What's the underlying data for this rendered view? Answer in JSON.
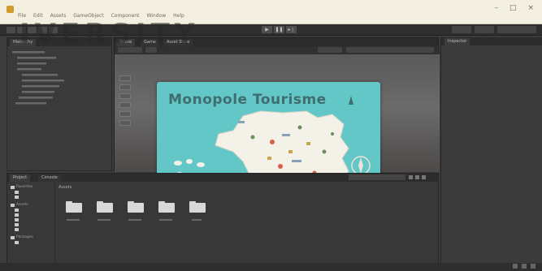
{
  "window": {
    "title": "",
    "menu": [
      "File",
      "Edit",
      "Assets",
      "GameObject",
      "Component",
      "Window",
      "Help"
    ]
  },
  "watermark": "IVERSITY",
  "toolbar": {
    "play": "▶",
    "pause": "❚❚",
    "step": "▸❘"
  },
  "hierarchy": {
    "tab_label": "Hierarchy",
    "items": [
      "",
      "",
      "",
      "",
      "",
      "",
      "",
      "",
      "",
      "",
      ""
    ]
  },
  "scene": {
    "tabs": [
      "Scene",
      "Game",
      "Asset Store"
    ]
  },
  "map": {
    "title": "Monopole Tourisme"
  },
  "inspector": {
    "tab_label": "Inspector"
  },
  "project": {
    "tabs": [
      "Project",
      "Console"
    ],
    "breadcrumb": "Assets",
    "tree": [
      "Favorites",
      "",
      "",
      "Assets",
      "",
      "",
      "",
      "",
      "",
      "Packages",
      ""
    ],
    "folders": [
      "",
      "",
      "",
      "",
      ""
    ]
  },
  "colors": {
    "map_sea": "#63c7c7",
    "map_land": "#f4f1e8",
    "title_text": "#3f6d70"
  }
}
